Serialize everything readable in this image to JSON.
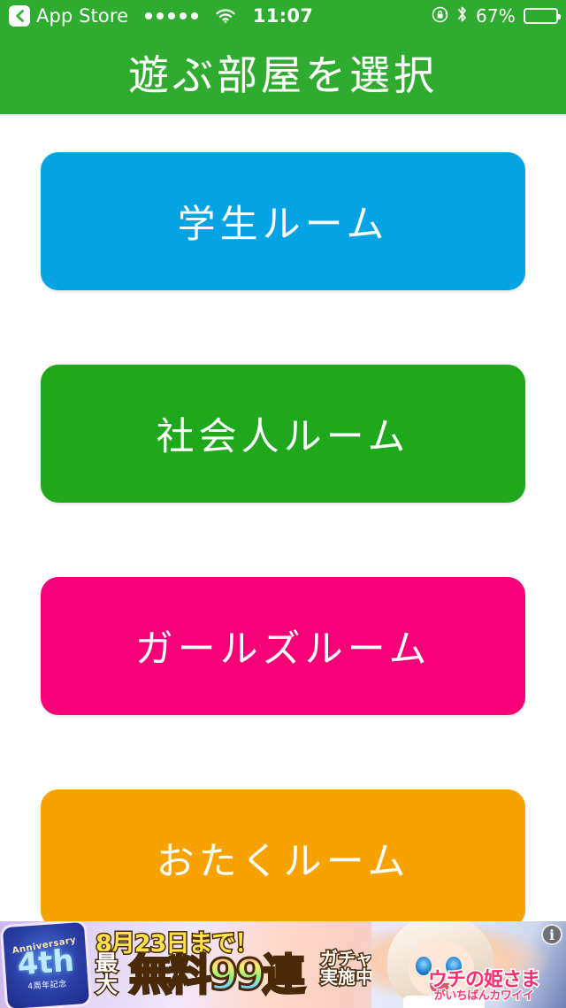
{
  "status_bar": {
    "back_label": "App Store",
    "back_icon": "chevron-left-icon",
    "signal_dots": 5,
    "wifi_icon": "wifi-icon",
    "time": "11:07",
    "rotation_lock_icon": "rotation-lock-icon",
    "bluetooth_icon": "bluetooth-icon",
    "battery_percent": "67%",
    "battery_level": 67
  },
  "header": {
    "title": "遊ぶ部屋を選択",
    "background_color": "#2fab2f"
  },
  "rooms": [
    {
      "label": "学生ルーム",
      "color": "#04a4e4"
    },
    {
      "label": "社会人ルーム",
      "color": "#1fa81b"
    },
    {
      "label": "ガールズルーム",
      "color": "#f50077"
    },
    {
      "label": "おたくルーム",
      "color": "#f8a200"
    }
  ],
  "ad": {
    "anniversary_word": "Anniversary",
    "anniversary_number": "4th",
    "anniversary_sub": "4周年記念",
    "headline": "8月23日まで！",
    "max_label": "最大",
    "free_label": "無料99連",
    "gacha_label": "ガチャ\n実施中♪",
    "game_title_main": "ウチの姫さま",
    "game_title_sub": "がいちばんカワイイ",
    "info_icon": "info-icon",
    "info_label": "i"
  }
}
